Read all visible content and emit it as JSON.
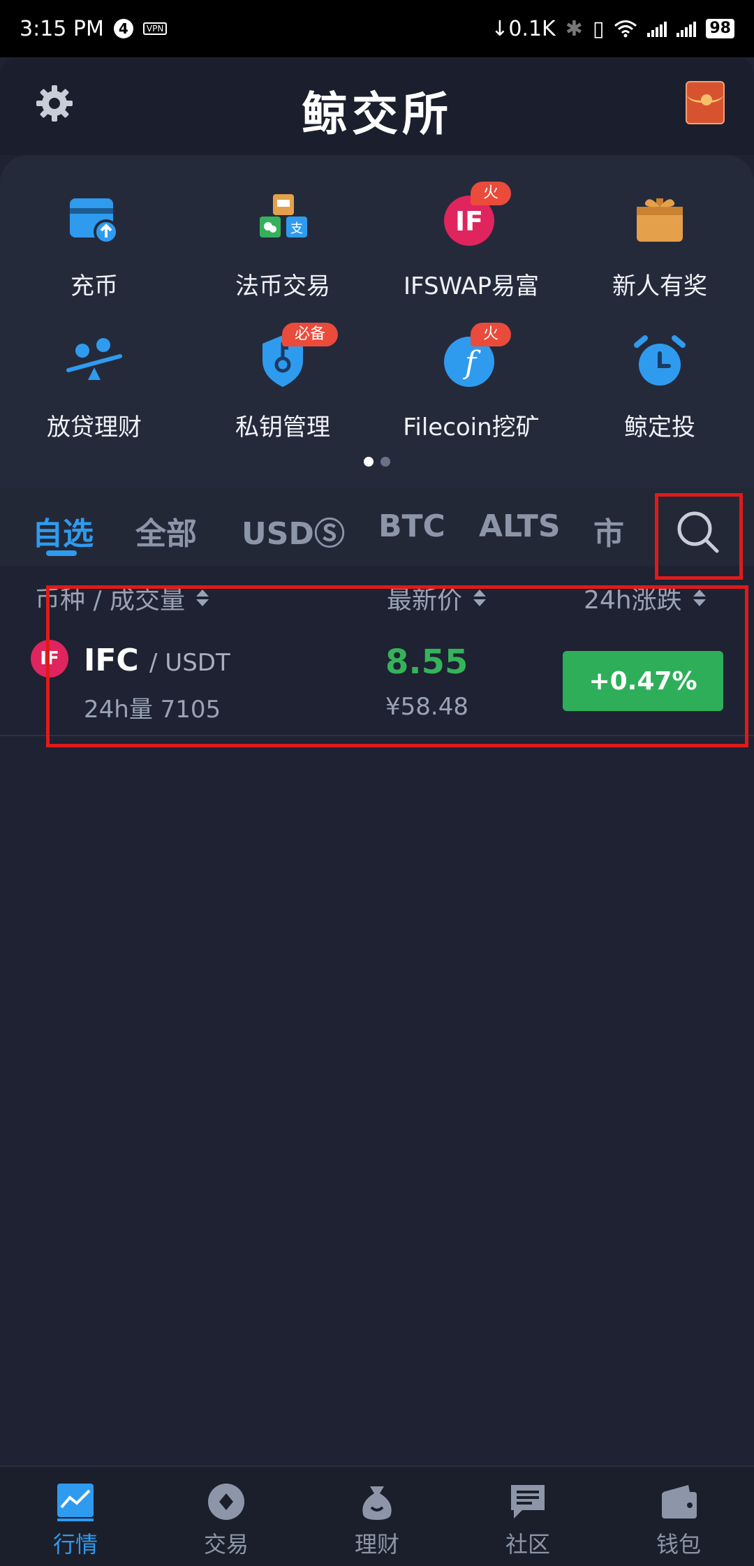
{
  "status_bar": {
    "time": "3:15 PM",
    "notif_count": "4",
    "vpn": "VPN",
    "net_speed": "↓0.1K",
    "battery": "98"
  },
  "header": {
    "title": "鲸交所",
    "settings_icon": "gear-icon",
    "gift_icon": "red-envelope-icon"
  },
  "shortcuts": [
    {
      "label": "充币",
      "icon": "deposit-icon",
      "tag": ""
    },
    {
      "label": "法币交易",
      "icon": "fiat-trade-icon",
      "tag": ""
    },
    {
      "label": "IFSWAP易富",
      "icon": "ifswap-icon",
      "tag": "火"
    },
    {
      "label": "新人有奖",
      "icon": "gift-box-icon",
      "tag": ""
    },
    {
      "label": "放贷理财",
      "icon": "lending-icon",
      "tag": ""
    },
    {
      "label": "私钥管理",
      "icon": "key-shield-icon",
      "tag": "必备"
    },
    {
      "label": "Filecoin挖矿",
      "icon": "filecoin-icon",
      "tag": "火"
    },
    {
      "label": "鲸定投",
      "icon": "alarm-clock-icon",
      "tag": ""
    }
  ],
  "colors": {
    "accent": "#2f9bef",
    "up_green": "#2fae5a",
    "hot_tag": "#ea4b3a",
    "background": "#1e2232"
  },
  "tabs": [
    {
      "label": "自选",
      "active": true
    },
    {
      "label": "全部",
      "active": false
    },
    {
      "label": "USDⓈ",
      "active": false
    },
    {
      "label": "BTC",
      "active": false
    },
    {
      "label": "ALTS",
      "active": false
    },
    {
      "label": "市",
      "active": false
    }
  ],
  "columns": {
    "pair_volume": "币种 / 成交量",
    "latest_price": "最新价",
    "change_24h": "24h涨跌"
  },
  "market_rows": [
    {
      "logo_text": "IF",
      "base": "IFC",
      "quote": "/ USDT",
      "volume": "24h量  7105",
      "price": "8.55",
      "price_cny": "¥58.48",
      "change": "+0.47%"
    }
  ],
  "bottom_nav": [
    {
      "label": "行情",
      "icon": "market-chart-icon",
      "active": true
    },
    {
      "label": "交易",
      "icon": "trade-coin-icon",
      "active": false
    },
    {
      "label": "理财",
      "icon": "money-bag-icon",
      "active": false
    },
    {
      "label": "社区",
      "icon": "chat-bubble-icon",
      "active": false
    },
    {
      "label": "钱包",
      "icon": "wallet-icon",
      "active": false
    }
  ]
}
